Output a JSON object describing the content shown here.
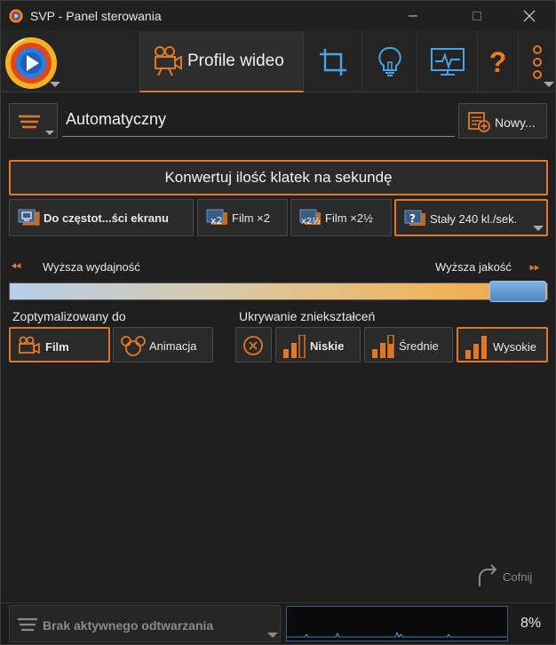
{
  "window": {
    "title": "SVP - Panel sterowania",
    "minimize_icon": "minimize-icon",
    "maximize_icon": "maximize-icon",
    "close_icon": "close-icon"
  },
  "nav": {
    "active_tab_label": "Profile wideo",
    "tabs": [
      "video-profiles",
      "crop",
      "lightbulb",
      "monitor",
      "help",
      "more"
    ],
    "help_glyph": "?"
  },
  "profile": {
    "name": "Automatyczny",
    "new_label": "Nowy..."
  },
  "convert": {
    "label": "Konwertuj ilość klatek na sekundę"
  },
  "fps_options": [
    {
      "label": "Do częstot...ści ekranu",
      "selected": false
    },
    {
      "label": "Film ×2",
      "selected": false
    },
    {
      "label": "Film ×2½",
      "selected": false
    },
    {
      "label": "Stały 240 kl./sek.",
      "selected": true
    }
  ],
  "quality": {
    "left_label": "Wyższa wydajność",
    "right_label": "Wyższa jakość",
    "value_fraction": 0.95
  },
  "optimize": {
    "section_label": "Zoptymalizowany do",
    "film_label": "Film",
    "animation_label": "Animacja",
    "selected": "Film"
  },
  "artifacts": {
    "section_label": "Ukrywanie zniekształceń",
    "low_label": "Niskie",
    "medium_label": "Średnie",
    "high_label": "Wysokie",
    "selected": "Wysokie"
  },
  "undo": {
    "label": "Cofnij"
  },
  "status": {
    "playback_label": "Brak aktywnego odtwarzania",
    "cpu_value": "8%"
  },
  "colors": {
    "accent": "#e07828",
    "background": "#1f1f1f",
    "graph_border": "#2d5f8a",
    "slider_thumb": "#5a92cf"
  }
}
